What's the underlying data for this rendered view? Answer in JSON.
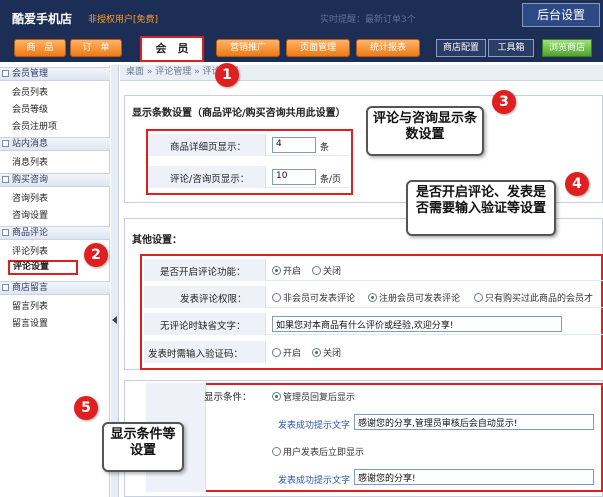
{
  "header": {
    "shop_title": "酷爱手机店",
    "user_status": "非授权用户[免费]",
    "realtime": "实时提醒：最新订单3个",
    "admin_tag": "后台设置",
    "nav": [
      "商　品",
      "订　单",
      "会　员",
      "营销推广",
      "页面管理",
      "统计报表"
    ],
    "utils": [
      "商店配置",
      "工具箱"
    ],
    "browse": "浏览商店"
  },
  "sidebar": {
    "groups": [
      {
        "title": "会员管理",
        "items": [
          "会员列表",
          "会员等级",
          "会员注册项"
        ]
      },
      {
        "title": "站内消息",
        "items": [
          "消息列表"
        ]
      },
      {
        "title": "购买咨询",
        "items": [
          "咨询列表",
          "咨询设置"
        ]
      },
      {
        "title": "商品评论",
        "items": [
          "评论列表",
          "评论设置"
        ]
      },
      {
        "title": "商店留言",
        "items": [
          "留言列表",
          "留言设置"
        ]
      }
    ]
  },
  "breadcrumb": "桌面 » 评论管理 » 评论设置",
  "display_section": {
    "title": "显示条数设置（商品评论/购买咨询共用此设置）",
    "rows": [
      {
        "label": "商品详细页显示：",
        "value": "4",
        "unit": "条"
      },
      {
        "label": "评论/咨询页显示：",
        "value": "10",
        "unit": "条/页"
      }
    ]
  },
  "other_section": {
    "title": "其他设置：",
    "enable": {
      "label": "是否开启评论功能：",
      "options": [
        "开启",
        "关闭"
      ],
      "selected": 0
    },
    "permission": {
      "label": "发表评论权限：",
      "options": [
        "非会员可发表评论",
        "注册会员可发表评论",
        "只有购买过此商品的会员才"
      ],
      "selected": 1
    },
    "default_text": {
      "label": "无评论时缺省文字：",
      "value": "如果您对本商品有什么评价或经验,欢迎分享!"
    },
    "captcha": {
      "label": "发表时需输入验证码：",
      "options": [
        "开启",
        "关闭"
      ],
      "selected": 1
    }
  },
  "display_cond": {
    "label": "显示条件：",
    "option1": "管理员回复后显示",
    "link1": "发表成功提示文字",
    "text1": "感谢您的分享,管理员审核后会自动显示!",
    "option2": "用户发表后立即显示",
    "link2": "发表成功提示文字",
    "text2": "感谢您的分享!",
    "selected": 0
  },
  "callouts": {
    "n1": "1",
    "n2": "2",
    "n3": "3",
    "n4": "4",
    "n5": "5",
    "c3": "评论与咨询显示条数设置",
    "c4": "是否开启评论、发表是否需要输入验证等设置",
    "c5": "显示条件等设置"
  },
  "colors": {
    "header_bg": "#1c2e55",
    "nav_orange": "#ee7a12",
    "highlight_red": "#e02020",
    "browse_green": "#4fa52c"
  }
}
